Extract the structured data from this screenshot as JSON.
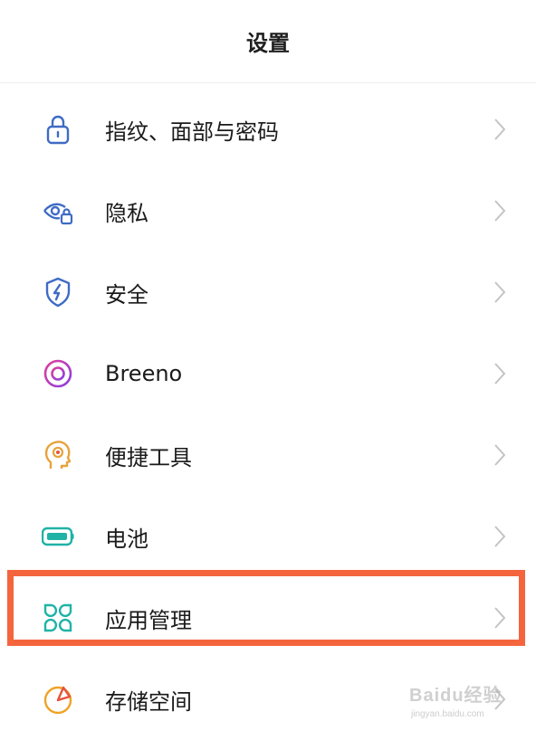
{
  "header": {
    "title": "设置"
  },
  "items": [
    {
      "label": "指纹、面部与密码",
      "icon": "lock-icon",
      "color": "#3f6bc4"
    },
    {
      "label": "隐私",
      "icon": "privacy-eye-lock-icon",
      "color": "#3f6bc4"
    },
    {
      "label": "安全",
      "icon": "shield-bolt-icon",
      "color": "#3f6bc4"
    },
    {
      "label": "Breeno",
      "icon": "breeno-ring-icon",
      "color": "#c23fd6"
    },
    {
      "label": "便捷工具",
      "icon": "head-target-icon",
      "color": "#e8a23a"
    },
    {
      "label": "电池",
      "icon": "battery-icon",
      "color": "#1fb3a6"
    },
    {
      "label": "应用管理",
      "icon": "app-grid-icon",
      "color": "#1fb3a6"
    },
    {
      "label": "存储空间",
      "icon": "storage-pie-icon",
      "color": "#f0a326"
    }
  ],
  "highlight_color": "#f4653e",
  "watermark": {
    "text": "Baidu经验",
    "sub": "jingyan.baidu.com"
  }
}
